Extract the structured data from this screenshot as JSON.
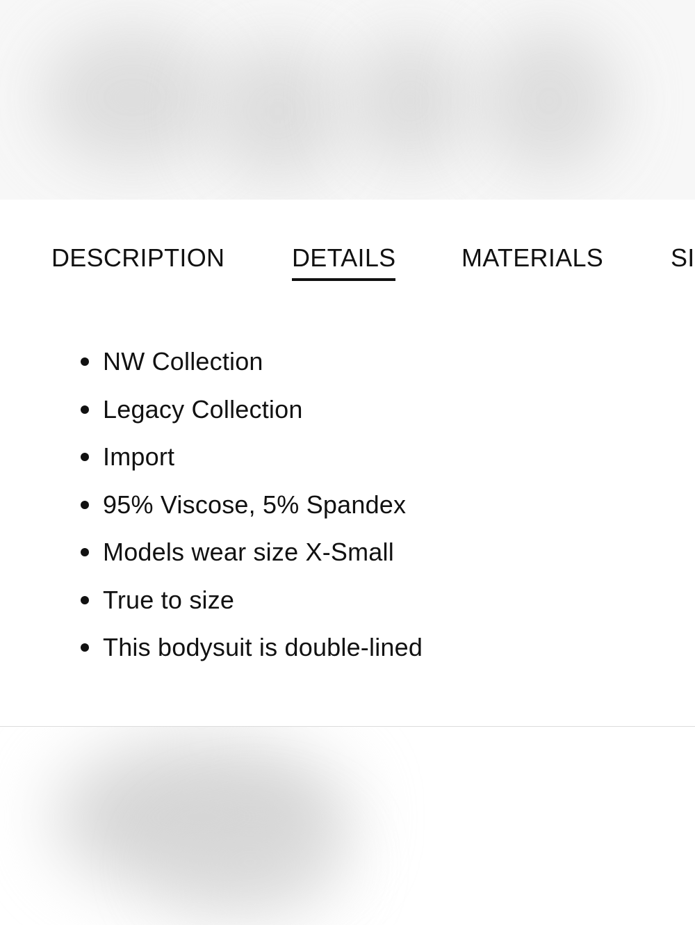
{
  "tabs": [
    {
      "label": "DESCRIPTION",
      "active": false
    },
    {
      "label": "DETAILS",
      "active": true
    },
    {
      "label": "MATERIALS",
      "active": false
    },
    {
      "label": "SI",
      "active": false
    }
  ],
  "details": {
    "items": [
      "NW Collection",
      "Legacy Collection",
      "Import",
      "95% Viscose, 5% Spandex",
      "Models wear size X-Small",
      "True to size",
      "This bodysuit is double-lined"
    ]
  },
  "colors": {
    "text": "#111111",
    "active_underline": "#111111",
    "divider": "#dcdcdc",
    "background": "#ffffff"
  }
}
